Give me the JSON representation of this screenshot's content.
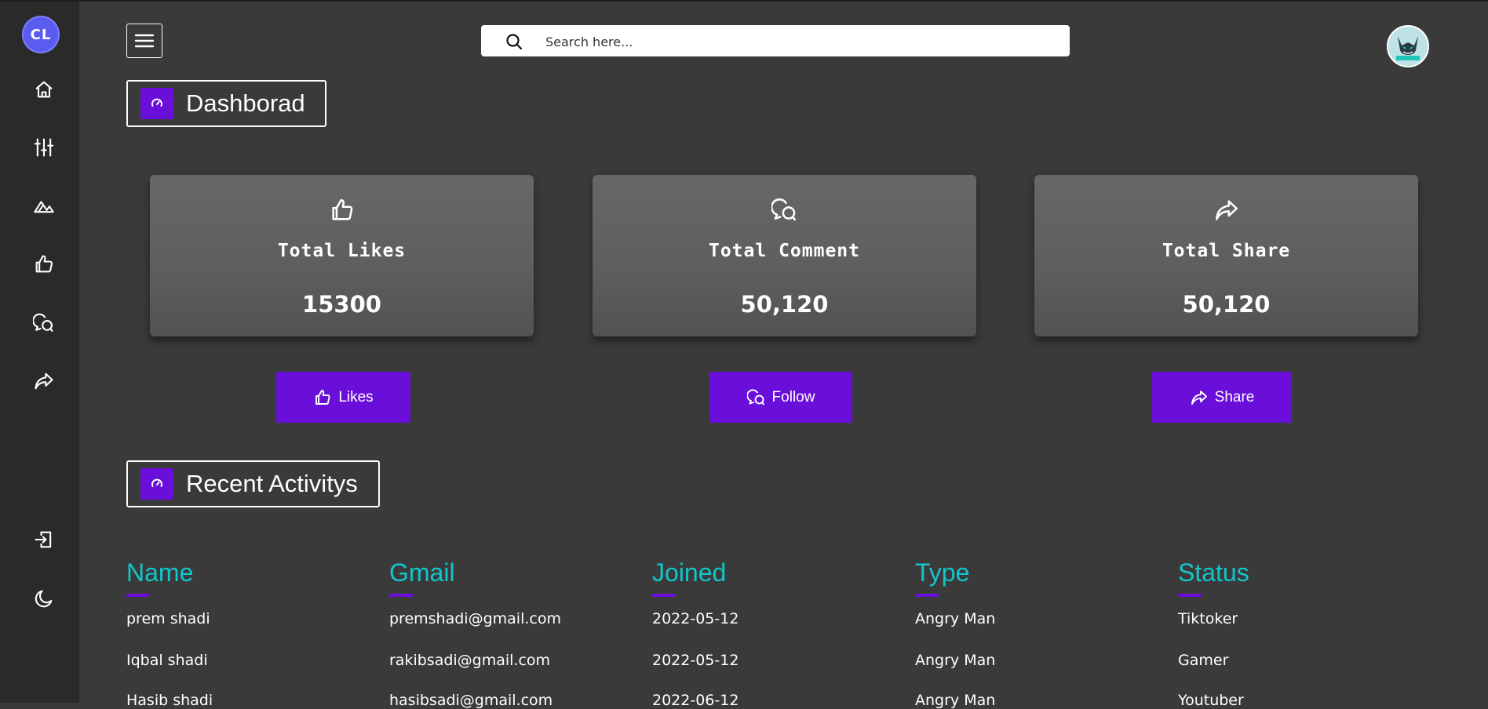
{
  "sidebar": {
    "logo_text": "CL",
    "icons": [
      "home-icon",
      "sliders-icon",
      "mountain-icon",
      "thumbs-up-icon",
      "chat-icon",
      "share-icon",
      "logout-icon",
      "moon-icon"
    ]
  },
  "header": {
    "search_placeholder": "Search here...",
    "avatar_text": "BUNNY"
  },
  "dashboard": {
    "title": "Dashborad"
  },
  "cards": [
    {
      "label": "Total Likes",
      "value": "15300",
      "icon": "thumbs-up-icon"
    },
    {
      "label": "Total Comment",
      "value": "50,120",
      "icon": "chat-icon"
    },
    {
      "label": "Total Share",
      "value": "50,120",
      "icon": "share-icon"
    }
  ],
  "actions": [
    {
      "label": "Likes",
      "icon": "thumbs-up-icon"
    },
    {
      "label": "Follow",
      "icon": "chat-icon"
    },
    {
      "label": "Share",
      "icon": "share-icon"
    }
  ],
  "recent": {
    "title": "Recent Activitys",
    "columns": [
      "Name",
      "Gmail",
      "Joined",
      "Type",
      "Status"
    ],
    "rows": [
      [
        "prem shadi",
        "premshadi@gmail.com",
        "2022-05-12",
        "Angry Man",
        "Tiktoker"
      ],
      [
        "Iqbal shadi",
        "rakibsadi@gmail.com",
        "2022-05-12",
        "Angry Man",
        "Gamer"
      ],
      [
        "Hasib shadi",
        "hasibsadi@gmail.com",
        "2022-06-12",
        "Angry Man",
        "Youtuber"
      ]
    ]
  },
  "colors": {
    "accent": "#6a0fd9",
    "heading_teal": "#12c6c9",
    "background": "#3a3a3b",
    "sidebar": "#2a2a2a"
  }
}
